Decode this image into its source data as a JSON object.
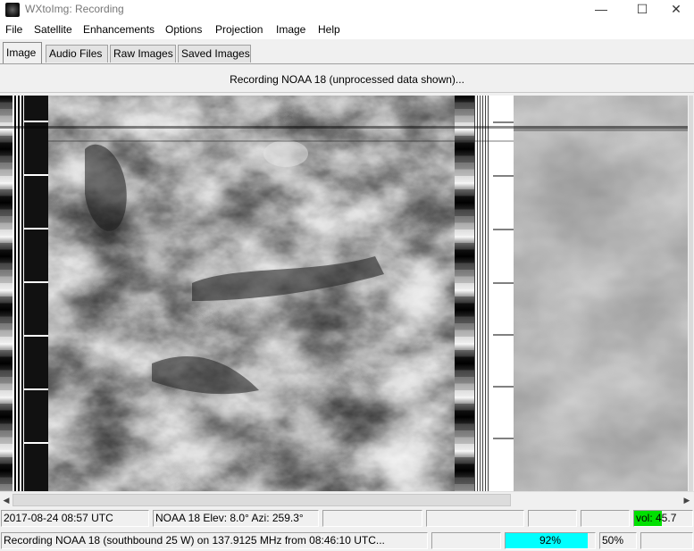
{
  "window": {
    "title": "WXtoImg: Recording",
    "minimize": "—",
    "maximize": "☐",
    "close": "✕"
  },
  "menu": [
    "File",
    "Satellite",
    "Enhancements",
    "Options",
    "Projection",
    "Image",
    "Help"
  ],
  "tabs": [
    "Image",
    "Audio Files",
    "Raw Images",
    "Saved Images"
  ],
  "active_tab": "Image",
  "header": "Recording NOAA 18 (unprocessed data shown)...",
  "status": {
    "datetime": "2017-08-24  08:57 UTC",
    "satellite_info": "NOAA 18   Elev: 8.0°   Azi: 259.3°",
    "volume": "vol: 45.7",
    "recording": "Recording NOAA 18 (southbound 25 W) on 137.9125 MHz from 08:46:10 UTC...",
    "progress": "92%",
    "progress_value": 0.92,
    "zoom": "50%"
  },
  "colors": {
    "progress": "#00ffff",
    "volume": "#00e000"
  }
}
